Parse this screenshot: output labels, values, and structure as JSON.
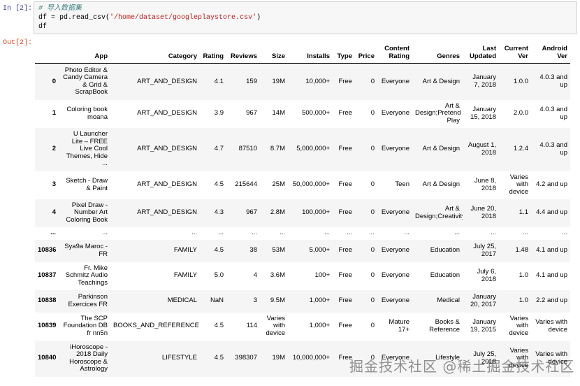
{
  "cell": {
    "in_prompt": "In  [2]:",
    "out_prompt": "Out[2]:",
    "code": {
      "comment": "# 导入数据集",
      "line2_pre": "df = pd.read_csv(",
      "line2_str": "'/home/dataset/googleplaystore.csv'",
      "line2_post": ")",
      "line3": "df"
    }
  },
  "table": {
    "columns": [
      "",
      "App",
      "Category",
      "Rating",
      "Reviews",
      "Size",
      "Installs",
      "Type",
      "Price",
      "Content Rating",
      "Genres",
      "Last Updated",
      "Current Ver",
      "Android Ver"
    ],
    "rows": [
      [
        "0",
        "Photo Editor & Candy Camera & Grid & ScrapBook",
        "ART_AND_DESIGN",
        "4.1",
        "159",
        "19M",
        "10,000+",
        "Free",
        "0",
        "Everyone",
        "Art & Design",
        "January 7, 2018",
        "1.0.0",
        "4.0.3 and up"
      ],
      [
        "1",
        "Coloring book moana",
        "ART_AND_DESIGN",
        "3.9",
        "967",
        "14M",
        "500,000+",
        "Free",
        "0",
        "Everyone",
        "Art & Design;Pretend Play",
        "January 15, 2018",
        "2.0.0",
        "4.0.3 and up"
      ],
      [
        "2",
        "U Launcher Lite – FREE Live Cool Themes, Hide ...",
        "ART_AND_DESIGN",
        "4.7",
        "87510",
        "8.7M",
        "5,000,000+",
        "Free",
        "0",
        "Everyone",
        "Art & Design",
        "August 1, 2018",
        "1.2.4",
        "4.0.3 and up"
      ],
      [
        "3",
        "Sketch - Draw & Paint",
        "ART_AND_DESIGN",
        "4.5",
        "215644",
        "25M",
        "50,000,000+",
        "Free",
        "0",
        "Teen",
        "Art & Design",
        "June 8, 2018",
        "Varies with device",
        "4.2 and up"
      ],
      [
        "4",
        "Pixel Draw - Number Art Coloring Book",
        "ART_AND_DESIGN",
        "4.3",
        "967",
        "2.8M",
        "100,000+",
        "Free",
        "0",
        "Everyone",
        "Art & Design;Creativity",
        "June 20, 2018",
        "1.1",
        "4.4 and up"
      ],
      [
        "...",
        "...",
        "...",
        "...",
        "...",
        "...",
        "...",
        "...",
        "...",
        "...",
        "...",
        "...",
        "...",
        "..."
      ],
      [
        "10836",
        "Sya9a Maroc - FR",
        "FAMILY",
        "4.5",
        "38",
        "53M",
        "5,000+",
        "Free",
        "0",
        "Everyone",
        "Education",
        "July 25, 2017",
        "1.48",
        "4.1 and up"
      ],
      [
        "10837",
        "Fr. Mike Schmitz Audio Teachings",
        "FAMILY",
        "5.0",
        "4",
        "3.6M",
        "100+",
        "Free",
        "0",
        "Everyone",
        "Education",
        "July 6, 2018",
        "1.0",
        "4.1 and up"
      ],
      [
        "10838",
        "Parkinson Exercices FR",
        "MEDICAL",
        "NaN",
        "3",
        "9.5M",
        "1,000+",
        "Free",
        "0",
        "Everyone",
        "Medical",
        "January 20, 2017",
        "1.0",
        "2.2 and up"
      ],
      [
        "10839",
        "The SCP Foundation DB fr nn5n",
        "BOOKS_AND_REFERENCE",
        "4.5",
        "114",
        "Varies with device",
        "1,000+",
        "Free",
        "0",
        "Mature 17+",
        "Books & Reference",
        "January 19, 2015",
        "Varies with device",
        "Varies with device"
      ],
      [
        "10840",
        "iHoroscope - 2018 Daily Horoscope & Astrology",
        "LIFESTYLE",
        "4.5",
        "398307",
        "19M",
        "10,000,000+",
        "Free",
        "0",
        "Everyone",
        "Lifestyle",
        "July 25, 2018",
        "Varies with device",
        "Varies with device"
      ]
    ]
  },
  "watermark": "掘金技术社区 @稀土掘金技术社区"
}
